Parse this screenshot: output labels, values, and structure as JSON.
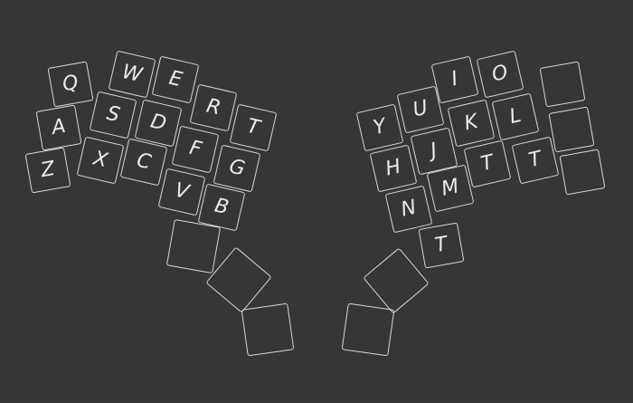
{
  "colors": {
    "background": "#363636",
    "stroke": "#d8d8d8",
    "text": "#ececec"
  },
  "left_half": {
    "col1": [
      "Q",
      "A",
      "Z"
    ],
    "col2": [
      "W",
      "S",
      "X"
    ],
    "col3": [
      "E",
      "D",
      "C"
    ],
    "col4": [
      "R",
      "F",
      "V"
    ],
    "col5": [
      "T",
      "G",
      "B"
    ],
    "thumbs": [
      "",
      "",
      ""
    ]
  },
  "right_half": {
    "col1": [
      "Y",
      "H",
      "N"
    ],
    "col2": [
      "U",
      "J",
      "M",
      "T"
    ],
    "col3": [
      "I",
      "K",
      "T"
    ],
    "col4": [
      "O",
      "L",
      "T"
    ],
    "col5": [
      "",
      "",
      ""
    ],
    "thumbs": [
      "",
      ""
    ]
  }
}
